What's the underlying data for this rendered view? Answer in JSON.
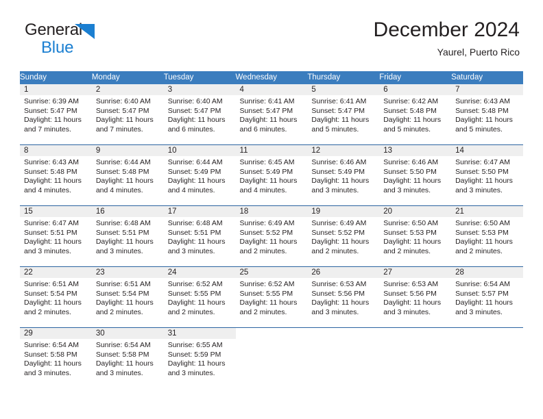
{
  "brand": {
    "line1": "General",
    "line2": "Blue",
    "mark": "triangle-logo",
    "accent_color": "#1b7fd1"
  },
  "header": {
    "title": "December 2024",
    "subtitle": "Yaurel, Puerto Rico"
  },
  "theme": {
    "header_row_bg": "#3b7dbe",
    "daynum_bg": "#efefef",
    "row_border": "#2a63a0",
    "text": "#231f20"
  },
  "weekday_headers": [
    "Sunday",
    "Monday",
    "Tuesday",
    "Wednesday",
    "Thursday",
    "Friday",
    "Saturday"
  ],
  "labels": {
    "sunrise_prefix": "Sunrise:",
    "sunset_prefix": "Sunset:",
    "daylight_prefix": "Daylight:"
  },
  "weeks": [
    [
      {
        "day": "1",
        "sunrise": "Sunrise: 6:39 AM",
        "sunset": "Sunset: 5:47 PM",
        "daylight_line1": "Daylight: 11 hours",
        "daylight_line2": "and 7 minutes."
      },
      {
        "day": "2",
        "sunrise": "Sunrise: 6:40 AM",
        "sunset": "Sunset: 5:47 PM",
        "daylight_line1": "Daylight: 11 hours",
        "daylight_line2": "and 7 minutes."
      },
      {
        "day": "3",
        "sunrise": "Sunrise: 6:40 AM",
        "sunset": "Sunset: 5:47 PM",
        "daylight_line1": "Daylight: 11 hours",
        "daylight_line2": "and 6 minutes."
      },
      {
        "day": "4",
        "sunrise": "Sunrise: 6:41 AM",
        "sunset": "Sunset: 5:47 PM",
        "daylight_line1": "Daylight: 11 hours",
        "daylight_line2": "and 6 minutes."
      },
      {
        "day": "5",
        "sunrise": "Sunrise: 6:41 AM",
        "sunset": "Sunset: 5:47 PM",
        "daylight_line1": "Daylight: 11 hours",
        "daylight_line2": "and 5 minutes."
      },
      {
        "day": "6",
        "sunrise": "Sunrise: 6:42 AM",
        "sunset": "Sunset: 5:48 PM",
        "daylight_line1": "Daylight: 11 hours",
        "daylight_line2": "and 5 minutes."
      },
      {
        "day": "7",
        "sunrise": "Sunrise: 6:43 AM",
        "sunset": "Sunset: 5:48 PM",
        "daylight_line1": "Daylight: 11 hours",
        "daylight_line2": "and 5 minutes."
      }
    ],
    [
      {
        "day": "8",
        "sunrise": "Sunrise: 6:43 AM",
        "sunset": "Sunset: 5:48 PM",
        "daylight_line1": "Daylight: 11 hours",
        "daylight_line2": "and 4 minutes."
      },
      {
        "day": "9",
        "sunrise": "Sunrise: 6:44 AM",
        "sunset": "Sunset: 5:48 PM",
        "daylight_line1": "Daylight: 11 hours",
        "daylight_line2": "and 4 minutes."
      },
      {
        "day": "10",
        "sunrise": "Sunrise: 6:44 AM",
        "sunset": "Sunset: 5:49 PM",
        "daylight_line1": "Daylight: 11 hours",
        "daylight_line2": "and 4 minutes."
      },
      {
        "day": "11",
        "sunrise": "Sunrise: 6:45 AM",
        "sunset": "Sunset: 5:49 PM",
        "daylight_line1": "Daylight: 11 hours",
        "daylight_line2": "and 4 minutes."
      },
      {
        "day": "12",
        "sunrise": "Sunrise: 6:46 AM",
        "sunset": "Sunset: 5:49 PM",
        "daylight_line1": "Daylight: 11 hours",
        "daylight_line2": "and 3 minutes."
      },
      {
        "day": "13",
        "sunrise": "Sunrise: 6:46 AM",
        "sunset": "Sunset: 5:50 PM",
        "daylight_line1": "Daylight: 11 hours",
        "daylight_line2": "and 3 minutes."
      },
      {
        "day": "14",
        "sunrise": "Sunrise: 6:47 AM",
        "sunset": "Sunset: 5:50 PM",
        "daylight_line1": "Daylight: 11 hours",
        "daylight_line2": "and 3 minutes."
      }
    ],
    [
      {
        "day": "15",
        "sunrise": "Sunrise: 6:47 AM",
        "sunset": "Sunset: 5:51 PM",
        "daylight_line1": "Daylight: 11 hours",
        "daylight_line2": "and 3 minutes."
      },
      {
        "day": "16",
        "sunrise": "Sunrise: 6:48 AM",
        "sunset": "Sunset: 5:51 PM",
        "daylight_line1": "Daylight: 11 hours",
        "daylight_line2": "and 3 minutes."
      },
      {
        "day": "17",
        "sunrise": "Sunrise: 6:48 AM",
        "sunset": "Sunset: 5:51 PM",
        "daylight_line1": "Daylight: 11 hours",
        "daylight_line2": "and 3 minutes."
      },
      {
        "day": "18",
        "sunrise": "Sunrise: 6:49 AM",
        "sunset": "Sunset: 5:52 PM",
        "daylight_line1": "Daylight: 11 hours",
        "daylight_line2": "and 2 minutes."
      },
      {
        "day": "19",
        "sunrise": "Sunrise: 6:49 AM",
        "sunset": "Sunset: 5:52 PM",
        "daylight_line1": "Daylight: 11 hours",
        "daylight_line2": "and 2 minutes."
      },
      {
        "day": "20",
        "sunrise": "Sunrise: 6:50 AM",
        "sunset": "Sunset: 5:53 PM",
        "daylight_line1": "Daylight: 11 hours",
        "daylight_line2": "and 2 minutes."
      },
      {
        "day": "21",
        "sunrise": "Sunrise: 6:50 AM",
        "sunset": "Sunset: 5:53 PM",
        "daylight_line1": "Daylight: 11 hours",
        "daylight_line2": "and 2 minutes."
      }
    ],
    [
      {
        "day": "22",
        "sunrise": "Sunrise: 6:51 AM",
        "sunset": "Sunset: 5:54 PM",
        "daylight_line1": "Daylight: 11 hours",
        "daylight_line2": "and 2 minutes."
      },
      {
        "day": "23",
        "sunrise": "Sunrise: 6:51 AM",
        "sunset": "Sunset: 5:54 PM",
        "daylight_line1": "Daylight: 11 hours",
        "daylight_line2": "and 2 minutes."
      },
      {
        "day": "24",
        "sunrise": "Sunrise: 6:52 AM",
        "sunset": "Sunset: 5:55 PM",
        "daylight_line1": "Daylight: 11 hours",
        "daylight_line2": "and 2 minutes."
      },
      {
        "day": "25",
        "sunrise": "Sunrise: 6:52 AM",
        "sunset": "Sunset: 5:55 PM",
        "daylight_line1": "Daylight: 11 hours",
        "daylight_line2": "and 2 minutes."
      },
      {
        "day": "26",
        "sunrise": "Sunrise: 6:53 AM",
        "sunset": "Sunset: 5:56 PM",
        "daylight_line1": "Daylight: 11 hours",
        "daylight_line2": "and 3 minutes."
      },
      {
        "day": "27",
        "sunrise": "Sunrise: 6:53 AM",
        "sunset": "Sunset: 5:56 PM",
        "daylight_line1": "Daylight: 11 hours",
        "daylight_line2": "and 3 minutes."
      },
      {
        "day": "28",
        "sunrise": "Sunrise: 6:54 AM",
        "sunset": "Sunset: 5:57 PM",
        "daylight_line1": "Daylight: 11 hours",
        "daylight_line2": "and 3 minutes."
      }
    ],
    [
      {
        "day": "29",
        "sunrise": "Sunrise: 6:54 AM",
        "sunset": "Sunset: 5:58 PM",
        "daylight_line1": "Daylight: 11 hours",
        "daylight_line2": "and 3 minutes."
      },
      {
        "day": "30",
        "sunrise": "Sunrise: 6:54 AM",
        "sunset": "Sunset: 5:58 PM",
        "daylight_line1": "Daylight: 11 hours",
        "daylight_line2": "and 3 minutes."
      },
      {
        "day": "31",
        "sunrise": "Sunrise: 6:55 AM",
        "sunset": "Sunset: 5:59 PM",
        "daylight_line1": "Daylight: 11 hours",
        "daylight_line2": "and 3 minutes."
      },
      {
        "day": "",
        "sunrise": "",
        "sunset": "",
        "daylight_line1": "",
        "daylight_line2": ""
      },
      {
        "day": "",
        "sunrise": "",
        "sunset": "",
        "daylight_line1": "",
        "daylight_line2": ""
      },
      {
        "day": "",
        "sunrise": "",
        "sunset": "",
        "daylight_line1": "",
        "daylight_line2": ""
      },
      {
        "day": "",
        "sunrise": "",
        "sunset": "",
        "daylight_line1": "",
        "daylight_line2": ""
      }
    ]
  ]
}
